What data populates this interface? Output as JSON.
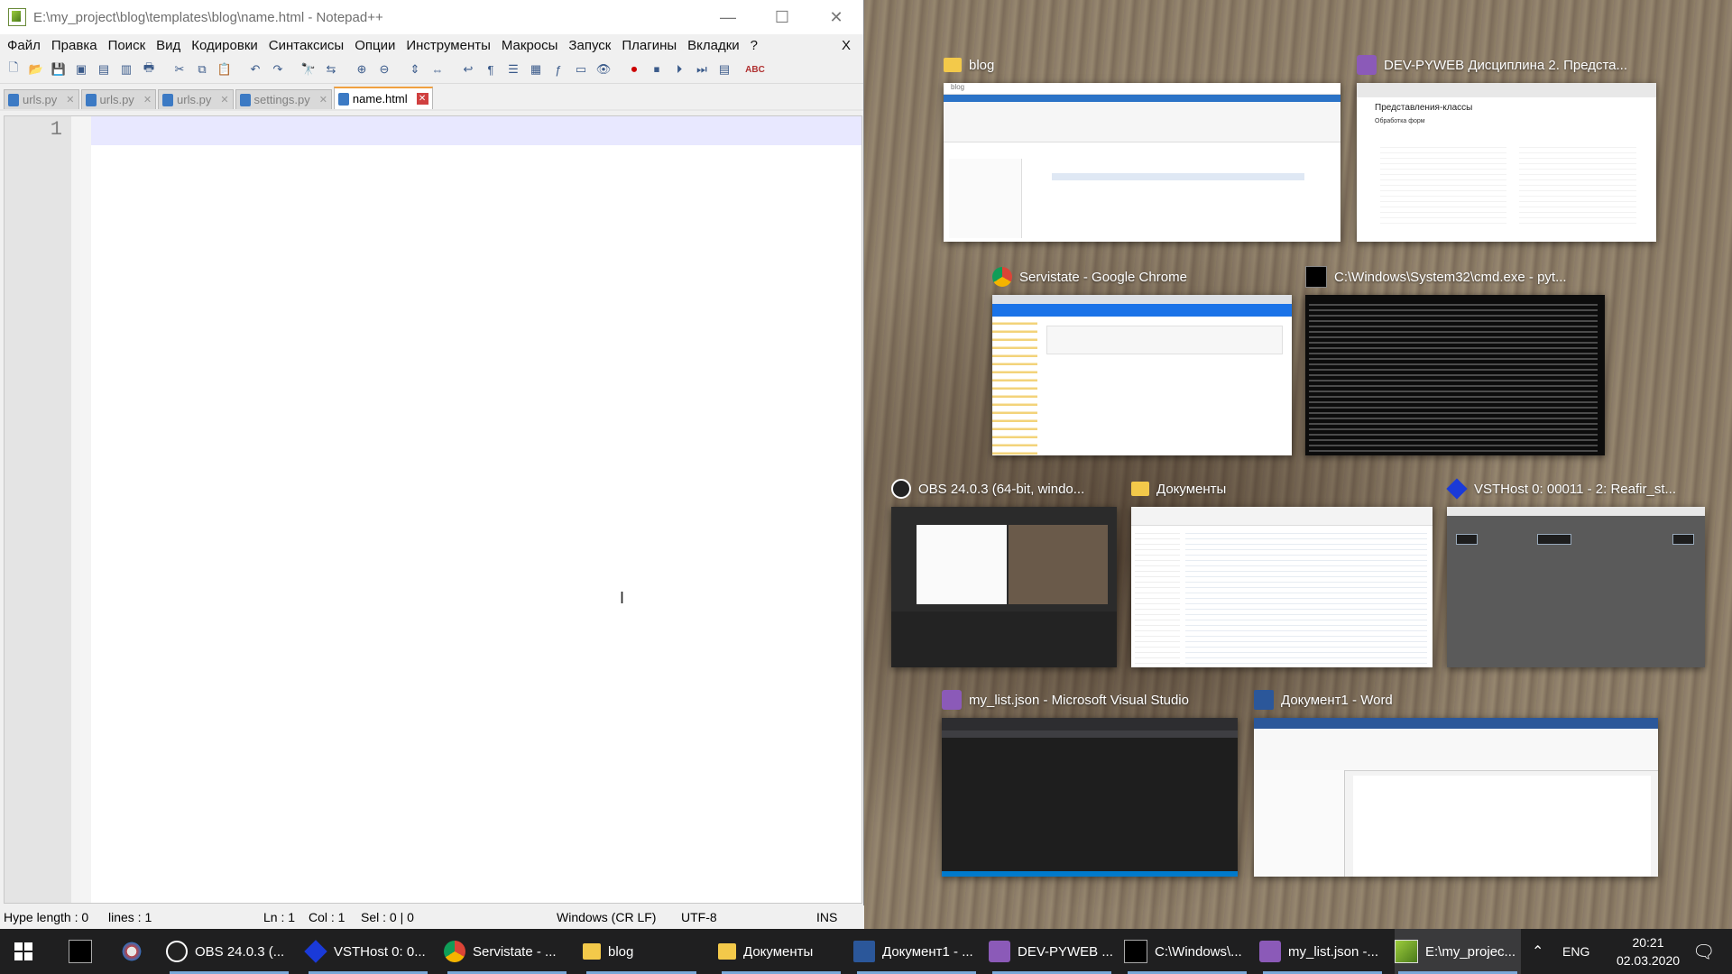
{
  "window": {
    "title": "E:\\my_project\\blog\\templates\\blog\\name.html - Notepad++",
    "controls": [
      "—",
      "☐",
      "✕"
    ]
  },
  "menu": [
    "Файл",
    "Правка",
    "Поиск",
    "Вид",
    "Кодировки",
    "Синтаксисы",
    "Опции",
    "Инструменты",
    "Макросы",
    "Запуск",
    "Плагины",
    "Вкладки",
    "?"
  ],
  "menu_close": "X",
  "tabs": [
    {
      "label": "urls.py",
      "active": false
    },
    {
      "label": "urls.py",
      "active": false
    },
    {
      "label": "urls.py",
      "active": false
    },
    {
      "label": "settings.py",
      "active": false
    },
    {
      "label": "name.html",
      "active": true
    }
  ],
  "editor": {
    "line_number": "1"
  },
  "status": {
    "type": "Hype length : 0",
    "lines": "lines : 1",
    "ln": "Ln : 1",
    "col": "Col : 1",
    "sel": "Sel : 0 | 0",
    "eol": "Windows (CR LF)",
    "encoding": "UTF-8",
    "mode": "INS"
  },
  "task_view": [
    {
      "title": "blog",
      "icon": "folder-icon"
    },
    {
      "title": "DEV-PYWEB Дисциплина 2. Предста...",
      "icon": "visual-studio-icon"
    },
    {
      "title": "Servistate - Google Chrome",
      "icon": "chrome-icon"
    },
    {
      "title": "C:\\Windows\\System32\\cmd.exe - pyt...",
      "icon": "cmd-icon"
    },
    {
      "title": "OBS 24.0.3 (64-bit, windo...",
      "icon": "obs-icon"
    },
    {
      "title": "Документы",
      "icon": "folder-icon"
    },
    {
      "title": "VSTHost 0: 00011 - 2: Reafir_st...",
      "icon": "vsthost-icon"
    },
    {
      "title": "my_list.json - Microsoft Visual Studio",
      "icon": "visual-studio-icon"
    },
    {
      "title": "Документ1 - Word",
      "icon": "word-icon"
    }
  ],
  "thumb_text": {
    "blog": "blog",
    "dev_heading": "Представления-классы",
    "dev_sub": "Обработка форм"
  },
  "taskbar": {
    "items": [
      {
        "label": "OBS 24.0.3 (...",
        "icon": "obs-icon"
      },
      {
        "label": "VSTHost 0: 0...",
        "icon": "vsthost-icon"
      },
      {
        "label": "Servistate - ...",
        "icon": "chrome-icon"
      },
      {
        "label": "blog",
        "icon": "folder-icon"
      },
      {
        "label": "Документы",
        "icon": "folder-icon"
      },
      {
        "label": "Документ1 - ...",
        "icon": "word-icon"
      },
      {
        "label": "DEV-PYWEB ...",
        "icon": "visual-studio-icon"
      },
      {
        "label": "C:\\Windows\\...",
        "icon": "cmd-icon"
      },
      {
        "label": "my_list.json -...",
        "icon": "visual-studio-icon"
      },
      {
        "label": "E:\\my_projec...",
        "icon": "notepadpp-icon"
      }
    ],
    "lang": "ENG",
    "time": "20:21",
    "date": "02.03.2020"
  },
  "colors": {
    "accent": "#7aa8d8",
    "taskbar": "#1f1f20",
    "current_line": "#e8e8ff"
  }
}
